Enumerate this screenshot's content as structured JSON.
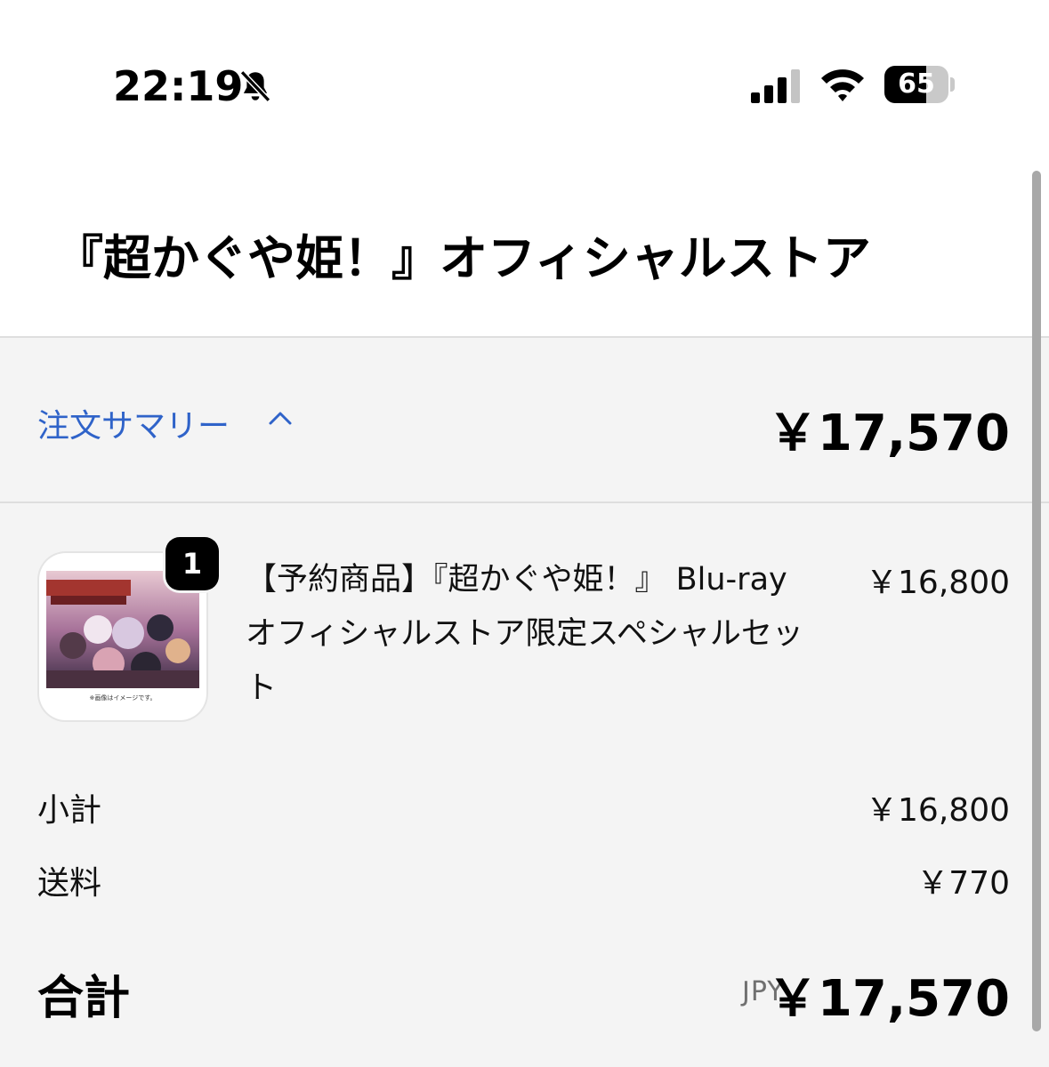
{
  "status_bar": {
    "time": "22:19",
    "battery_level": "65",
    "battery_fraction": 0.65,
    "icons": [
      "bell-slash-icon",
      "cellular-signal-icon",
      "wifi-icon",
      "battery-icon"
    ]
  },
  "header": {
    "title": "『超かぐや姫！』オフィシャルストア"
  },
  "summary": {
    "toggle_label": "注文サマリー",
    "toggle_icon": "chevron-up-icon",
    "total": "￥17,570"
  },
  "line_items": [
    {
      "quantity": "1",
      "name": "【予約商品】『超かぐや姫！』 Blu-ray オフィシャルストア限定スペシャルセット",
      "price": "￥16,800",
      "image_caption": "※画像はイメージです。"
    }
  ],
  "totals": {
    "subtotal_label": "小計",
    "subtotal_value": "￥16,800",
    "shipping_label": "送料",
    "shipping_value": "￥770",
    "total_label": "合計",
    "currency": "JPY",
    "total_value": "￥17,570"
  },
  "colors": {
    "link_blue": "#2f63c9",
    "panel_bg": "#f4f4f4",
    "divider": "#dedede"
  }
}
